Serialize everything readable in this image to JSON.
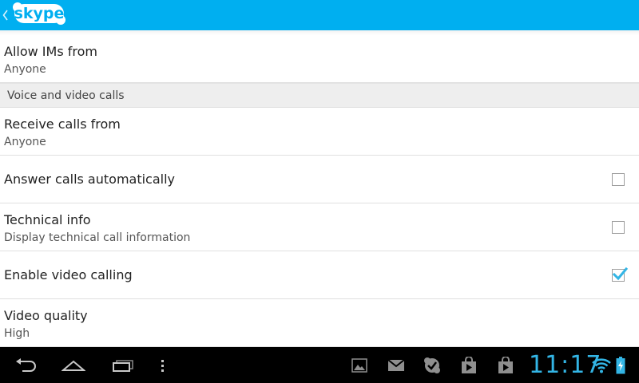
{
  "app": {
    "logo_text": "skype",
    "accent": "#00aff0"
  },
  "preferences": {
    "allow_ims": {
      "title": "Allow IMs from",
      "summary": "Anyone"
    },
    "category_calls": "Voice and video calls",
    "receive_calls": {
      "title": "Receive calls from",
      "summary": "Anyone"
    },
    "answer_auto": {
      "title": "Answer calls automatically",
      "checked": false
    },
    "technical_info": {
      "title": "Technical info",
      "summary": "Display technical call information",
      "checked": false
    },
    "enable_video": {
      "title": "Enable video calling",
      "checked": true
    },
    "video_quality": {
      "title": "Video quality",
      "summary": "High"
    }
  },
  "system_bar": {
    "time": "11:17",
    "nav_icons": [
      "back-icon",
      "home-icon",
      "recent-apps-icon",
      "menu-icon"
    ],
    "notification_icons": [
      "gallery-icon",
      "gmail-icon",
      "skype-notification-icon",
      "store-download-icon",
      "store-download-icon"
    ],
    "status_icons": [
      "wifi-icon",
      "battery-charging-icon"
    ],
    "clock_color": "#33b5e5"
  }
}
